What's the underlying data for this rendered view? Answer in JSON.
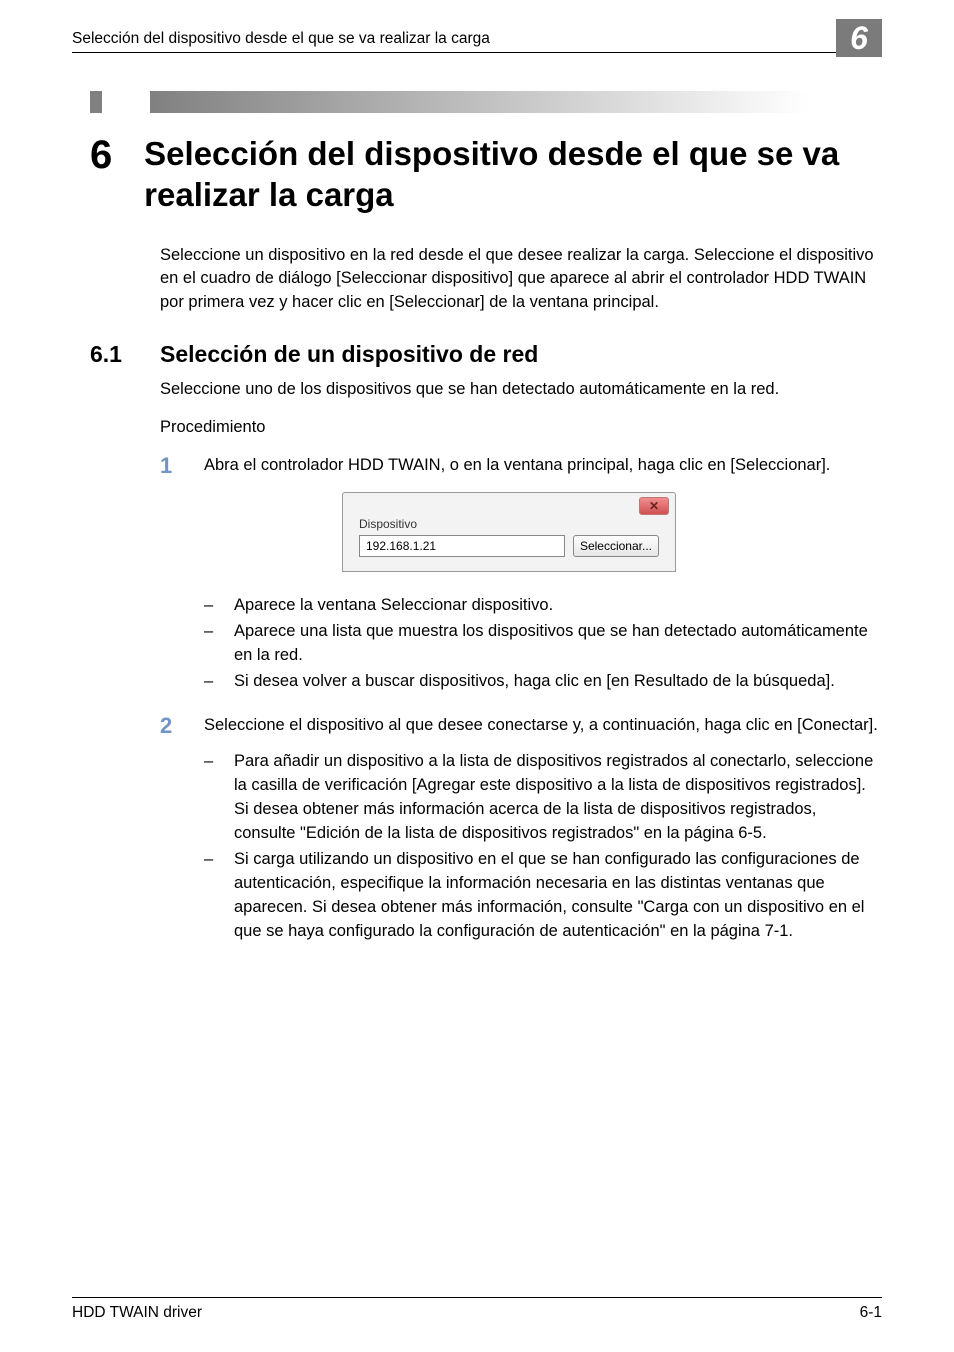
{
  "header": {
    "running_title": "Selección del dispositivo desde el que se va realizar la carga",
    "chapter_badge": "6"
  },
  "h1": {
    "num": "6",
    "text": "Selección del dispositivo desde el que se va realizar la carga"
  },
  "intro": "Seleccione un dispositivo en la red desde el que desee realizar la carga. Seleccione el dispositivo en el cuadro de diálogo [Seleccionar dispositivo] que aparece al abrir el controlador HDD TWAIN por primera vez y hacer clic en [Seleccionar] de la ventana principal.",
  "h2": {
    "num": "6.1",
    "text": "Selección de un dispositivo de red"
  },
  "para1": "Seleccione uno de los dispositivos que se han detectado automáticamente en la red.",
  "para2": "Procedimiento",
  "step1": {
    "num": "1",
    "text": "Abra el controlador HDD TWAIN, o en la ventana principal, haga clic en [Seleccionar]."
  },
  "dialog": {
    "group_label": "Dispositivo",
    "input_value": "192.168.1.21",
    "button_label": "Seleccionar..."
  },
  "sub1": [
    "Aparece la ventana Seleccionar dispositivo.",
    "Aparece una lista que muestra los dispositivos que se han detectado automáticamente en la red.",
    "Si desea volver a buscar dispositivos, haga clic en [en Resultado de la búsqueda]."
  ],
  "step2": {
    "num": "2",
    "text": "Seleccione el dispositivo al que desee conectarse y, a continuación, haga clic en [Conectar]."
  },
  "sub2": [
    "Para añadir un dispositivo a la lista de dispositivos registrados al conectarlo, seleccione la casilla de verificación [Agregar este dispositivo a la lista de dispositivos registrados]. Si desea obtener más información acerca de la lista de dispositivos registrados, consulte \"Edición de la lista de dispositivos registrados\" en la página 6-5.",
    "Si carga utilizando un dispositivo en el que se han configurado las configuraciones de autenticación, especifique la información necesaria en las distintas ventanas que aparecen. Si desea obtener más información, consulte \"Carga con un dispositivo en el que se haya configurado la configuración de autenticación\" en la página 7-1."
  ],
  "footer": {
    "left": "HDD TWAIN driver",
    "right": "6-1"
  },
  "dash": "–"
}
